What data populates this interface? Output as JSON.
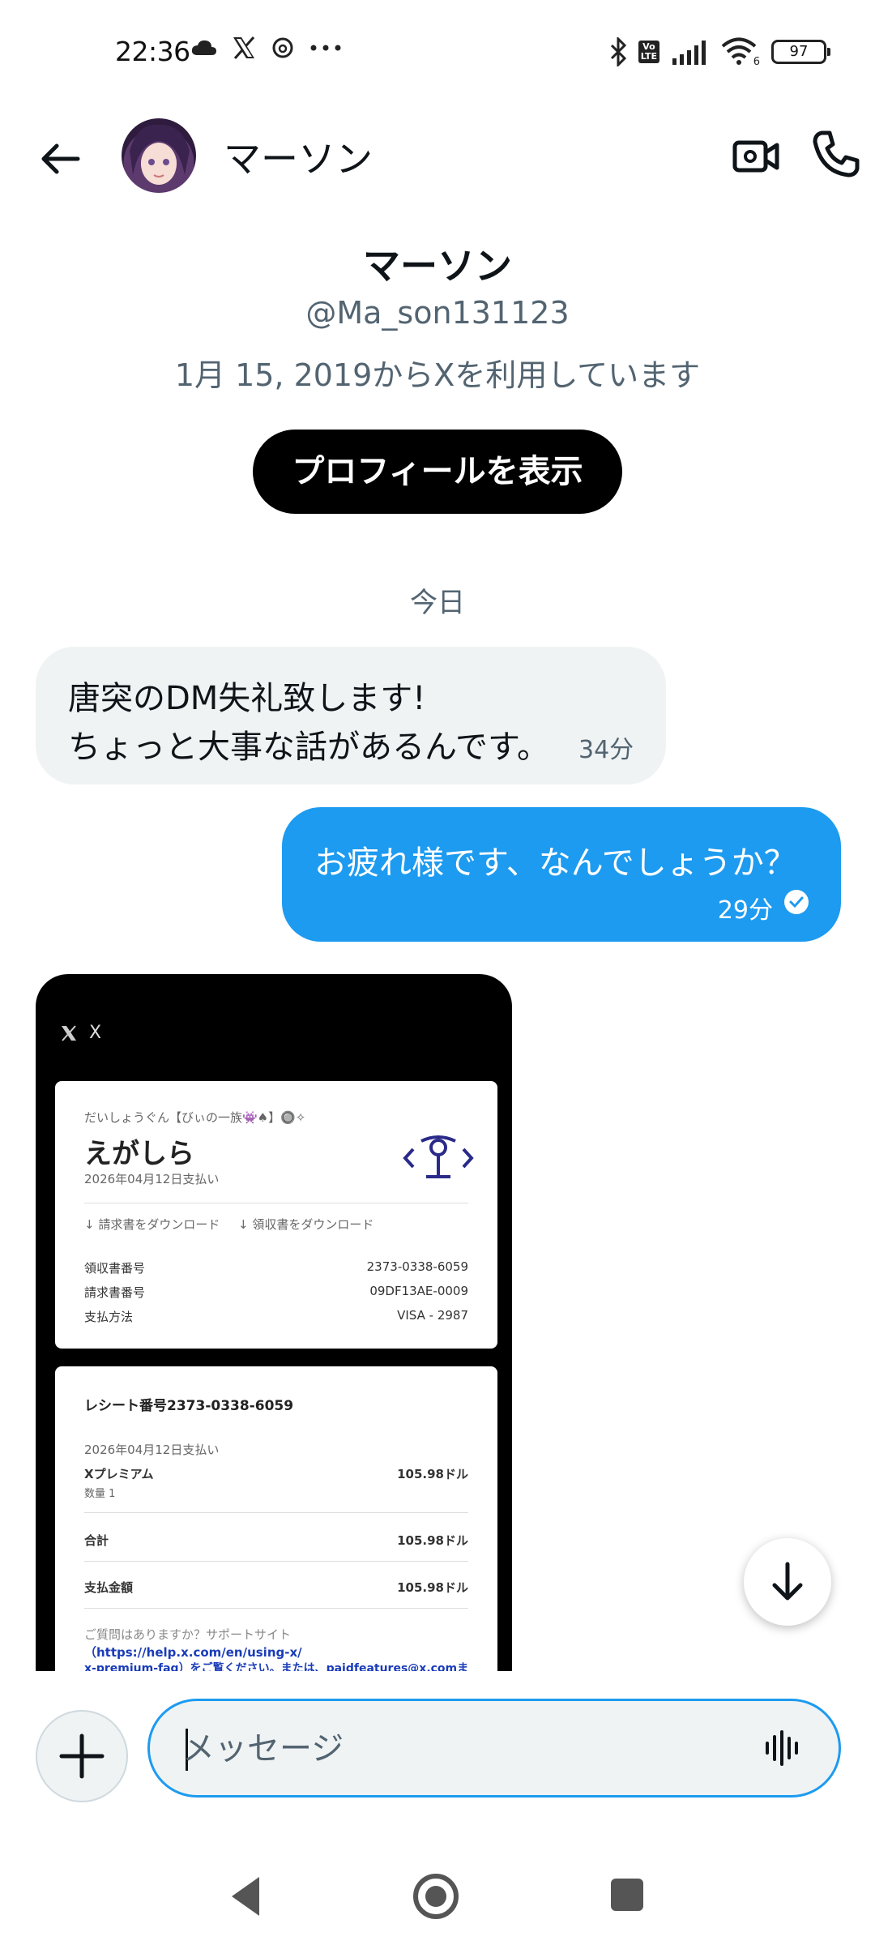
{
  "status_bar": {
    "time": "22:36",
    "left_icons": [
      "cloud-icon",
      "x-app-icon",
      "threads-icon",
      "more-dots-icon"
    ],
    "right_icons": [
      "bluetooth-icon",
      "volte-icon",
      "signal-icon",
      "wifi-icon"
    ],
    "volte_label": "Vo\nLTE",
    "wifi_badge": "6",
    "battery": "97"
  },
  "header": {
    "name": "マーソン",
    "back_icon": "arrow-left-icon",
    "video_icon": "video-call-icon",
    "call_icon": "phone-icon"
  },
  "profile": {
    "name": "マーソン",
    "handle": "@Ma_son131123",
    "since": "1月 15, 2019からXを利用しています",
    "button_label": "プロフィールを表示"
  },
  "date_divider": "今日",
  "messages": [
    {
      "direction": "incoming",
      "text": "唐突のDM失礼致します!\nちょっと大事な話があるんです。",
      "time": "34分"
    },
    {
      "direction": "outgoing",
      "text": "お疲れ様です、なんでしょうか？",
      "time": "29分"
    }
  ],
  "image_message": {
    "app_label": "X",
    "card1": {
      "small_heading": "だいしょうぐん【びぃの一族👾♠】🔘✧",
      "big_name": "えがしら",
      "paid_date": "2026年04月12日支払い",
      "download_invoice": "↓ 請求書をダウンロード",
      "download_receipt": "↓ 領収書をダウンロード",
      "rows": [
        {
          "label": "領収書番号",
          "value": "2373-0338-6059"
        },
        {
          "label": "請求書番号",
          "value": "09DF13AE-0009"
        },
        {
          "label": "支払方法",
          "value": "VISA - 2987"
        }
      ]
    },
    "card2": {
      "receipt_title": "レシート番号2373-0338-6059",
      "paid_date": "2026年04月12日支払い",
      "item_name": "Xプレミアム",
      "item_qty": "数量 1",
      "item_price": "105.98ドル",
      "total_label": "合計",
      "total_value": "105.98ドル",
      "paid_label": "支払金額",
      "paid_value": "105.98ドル",
      "support_text": "ご質問はありますか？サポートサイト",
      "support_link1": "（https://help.x.com/en/using-x/",
      "support_link2": "x-premium-faq）をご覧ください。または、paidfeatures@x.comま"
    }
  },
  "composer": {
    "placeholder": "メッセージ",
    "add_icon": "plus-icon",
    "voice_icon": "voice-wave-icon"
  },
  "nav": {
    "back_icon": "nav-back-icon",
    "home_icon": "nav-home-icon",
    "recents_icon": "nav-recents-icon"
  }
}
